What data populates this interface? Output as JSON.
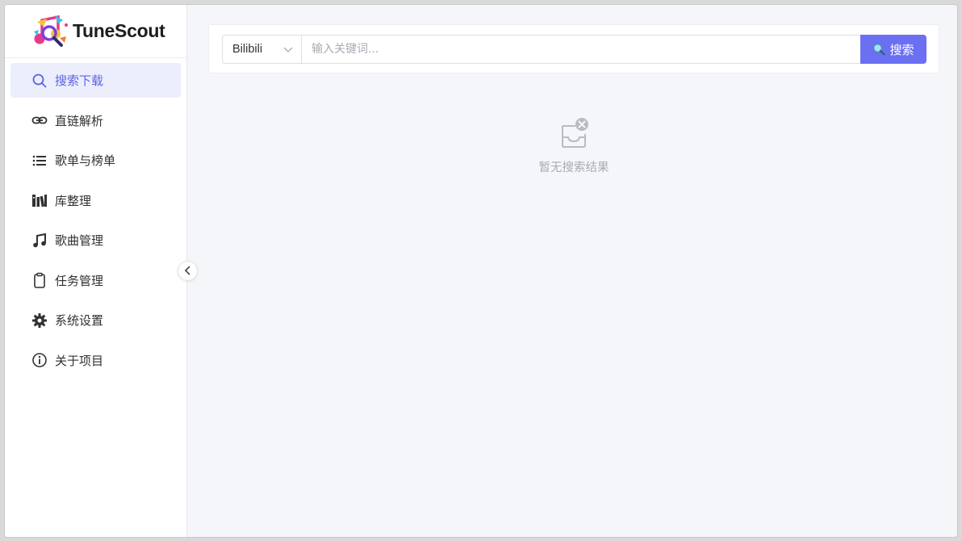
{
  "app": {
    "name": "TuneScout"
  },
  "sidebar": {
    "items": [
      {
        "label": "搜索下载",
        "icon": "search-icon",
        "active": true
      },
      {
        "label": "直链解析",
        "icon": "link-icon"
      },
      {
        "label": "歌单与榜单",
        "icon": "list-icon"
      },
      {
        "label": "库整理",
        "icon": "library-icon"
      },
      {
        "label": "歌曲管理",
        "icon": "music-note-icon"
      },
      {
        "label": "任务管理",
        "icon": "clipboard-icon"
      },
      {
        "label": "系统设置",
        "icon": "gear-icon"
      },
      {
        "label": "关于项目",
        "icon": "info-icon"
      }
    ]
  },
  "search": {
    "source_value": "Bilibili",
    "placeholder": "输入关键词...",
    "button_label": "搜索"
  },
  "results": {
    "empty_text": "暂无搜索结果"
  },
  "colors": {
    "accent": "#6b70f2",
    "active_bg": "#eceefc",
    "active_text": "#5b63e6",
    "background": "#f5f6fa"
  }
}
